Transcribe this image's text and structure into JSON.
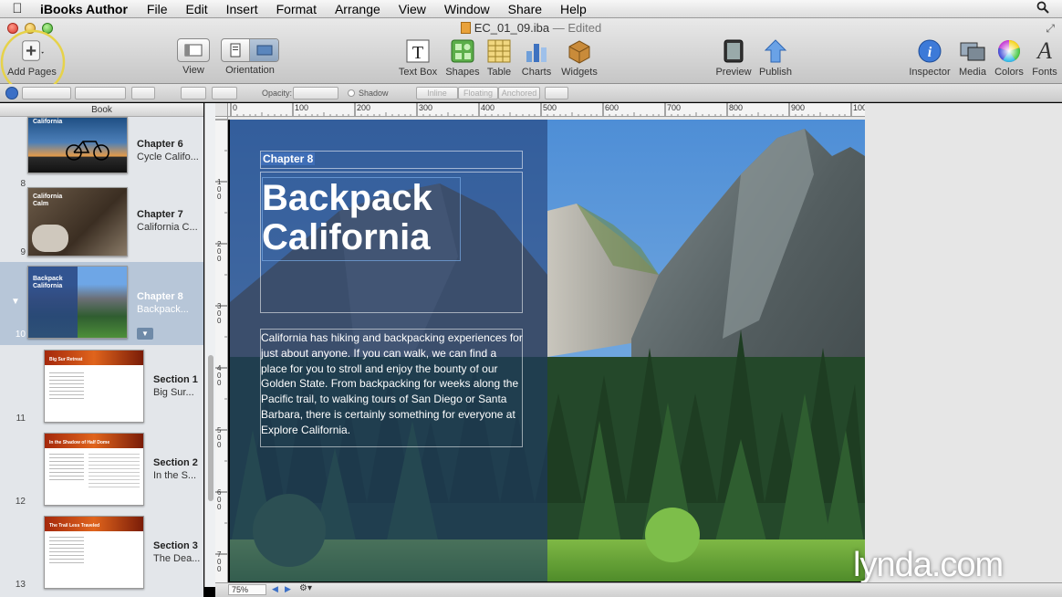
{
  "menubar": {
    "app_name": "iBooks Author",
    "items": [
      "File",
      "Edit",
      "Insert",
      "Format",
      "Arrange",
      "View",
      "Window",
      "Share",
      "Help"
    ]
  },
  "window": {
    "doc_name": "EC_01_09.iba",
    "doc_status": "— Edited"
  },
  "toolbar": {
    "add_pages": "Add Pages",
    "view": "View",
    "orientation": "Orientation",
    "text_box": "Text Box",
    "shapes": "Shapes",
    "table": "Table",
    "charts": "Charts",
    "widgets": "Widgets",
    "preview": "Preview",
    "publish": "Publish",
    "inspector": "Inspector",
    "media": "Media",
    "colors": "Colors",
    "fonts": "Fonts",
    "fonts_glyph": "A"
  },
  "formatbar": {
    "opacity_label": "Opacity:",
    "shadow_label": "Shadow",
    "wrap_inline": "Inline",
    "wrap_floating": "Floating",
    "wrap_anchored": "Anchored"
  },
  "sidebar": {
    "header": "Book",
    "items": [
      {
        "num": "8",
        "title": "Chapter 6",
        "subtitle": "Cycle Califo..."
      },
      {
        "num": "9",
        "title": "Chapter 7",
        "subtitle": "California C..."
      },
      {
        "num": "10",
        "title": "Chapter 8",
        "subtitle": "Backpack..."
      },
      {
        "num": "11",
        "title": "Section 1",
        "subtitle": "Big Sur..."
      },
      {
        "num": "12",
        "title": "Section 2",
        "subtitle": "In the S..."
      },
      {
        "num": "13",
        "title": "Section 3",
        "subtitle": "The Dea..."
      }
    ],
    "thumb_texts": [
      "California",
      "California Calm",
      "Backpack California",
      "Big Sur Retreat",
      "In the Shadow of Half Dome",
      "The Trail Less Traveled"
    ]
  },
  "ruler": {
    "h_labels": [
      "0",
      "100",
      "200",
      "300",
      "400",
      "500",
      "600",
      "700",
      "800",
      "900",
      "100"
    ],
    "v_labels": [
      "100",
      "200",
      "300",
      "400",
      "500",
      "600",
      "700"
    ]
  },
  "page": {
    "chapter_label": "Chapter 8",
    "title_line1": "Backpack",
    "title_line2": "California",
    "body": "California has hiking and backpacking experiences for just about anyone. If you can walk, we can find a place for you to stroll and enjoy the bounty of our Golden State. From backpacking for weeks along the Pacific trail, to walking tours of San Diego or Santa Barbara, there is certainly something for everyone at Explore California."
  },
  "bottombar": {
    "zoom": "75%"
  },
  "watermark": "lynda.com",
  "colors": {
    "overlay": "#1e376e",
    "sky": "#4e8ed6",
    "sidebar_selected": "#b7c6d8"
  }
}
